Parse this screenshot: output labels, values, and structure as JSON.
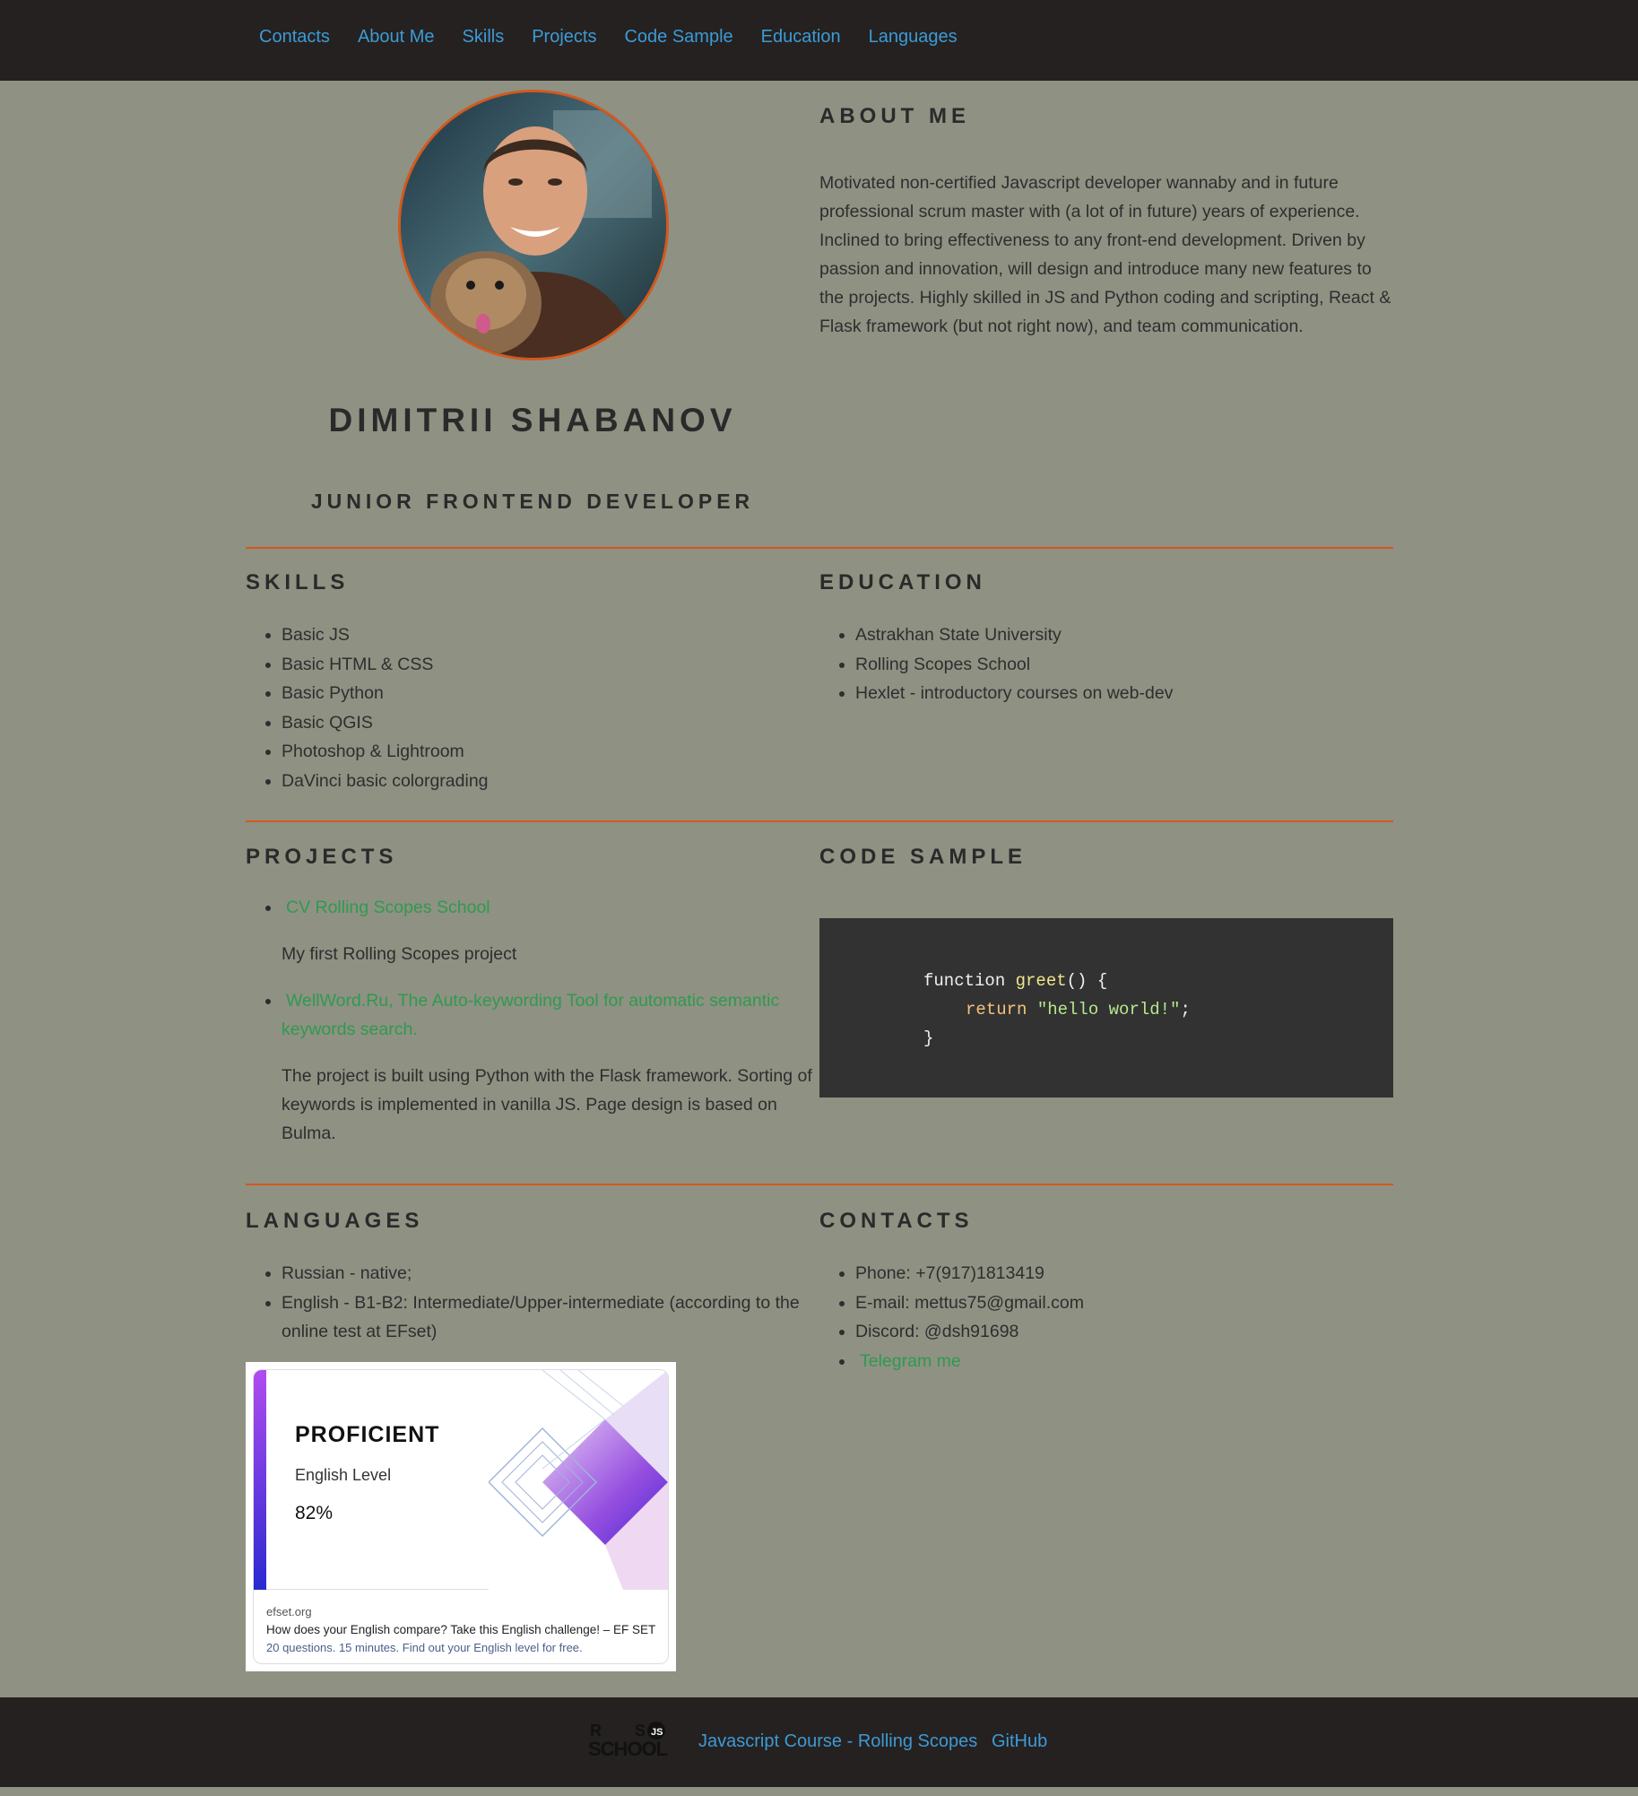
{
  "nav": {
    "items": [
      "Contacts",
      "About Me",
      "Skills",
      "Projects",
      "Code Sample",
      "Education",
      "Languages"
    ]
  },
  "profile": {
    "name": "DIMITRII SHABANOV",
    "role": "JUNIOR FRONTEND DEVELOPER"
  },
  "about": {
    "title": "ABOUT ME",
    "text": "Motivated non-certified Javascript developer wannaby and in future professional scrum master with (a lot of in future) years of experience. Inclined to bring effectiveness to any front-end development. Driven by passion and innovation, will design and introduce many new features to the projects. Highly skilled in JS and Python coding and scripting, React & Flask framework (but not right now), and team communication."
  },
  "skills": {
    "title": "SKILLS",
    "items": [
      "Basic JS",
      "Basic HTML & CSS",
      "Basic Python",
      "Basic QGIS",
      "Photoshop & Lightroom",
      "DaVinci basic colorgrading"
    ]
  },
  "education": {
    "title": "EDUCATION",
    "items": [
      "Astrakhan State University",
      "Rolling Scopes School",
      "Hexlet - introductory courses on web-dev"
    ]
  },
  "projects": {
    "title": "PROJECTS",
    "items": [
      {
        "link": "CV Rolling Scopes School",
        "desc": "My first Rolling Scopes project"
      },
      {
        "link": "WellWord.Ru, The Auto-keywording Tool for automatic semantic keywords search.",
        "desc": "The project is built using Python with the Flask framework. Sorting of keywords is implemented in vanilla JS. Page design is based on Bulma."
      }
    ]
  },
  "code": {
    "title": "CODE SAMPLE",
    "kw_function": "function",
    "fn_name": "greet",
    "sig_rest": "() {",
    "kw_return": "return",
    "str": "\"hello world!\"",
    "semi": ";",
    "close": "}"
  },
  "languages": {
    "title": "LANGUAGES",
    "items": [
      "Russian - native;",
      "English - B1-B2: Intermediate/Upper-intermediate (according to the online test at EFset)"
    ]
  },
  "efset": {
    "level": "PROFICIENT",
    "subtitle": "English Level",
    "percent": "82%",
    "site": "efset.org",
    "question": "How does your English compare? Take this English challenge! – EF SET",
    "note": "20 questions. 15 minutes. Find out your English level for free."
  },
  "contacts": {
    "title": "CONTACTS",
    "items": [
      "Phone: +7(917)1813419",
      "E-mail: mettus75@gmail.com",
      "Discord: @dsh91698"
    ],
    "telegram": "Telegram me"
  },
  "footer": {
    "logo_text": "RS SCHOOL",
    "course": "Javascript Course - Rolling Scopes",
    "github": "GitHub"
  },
  "colors": {
    "background": "#8f9183",
    "nav_bg": "#242120",
    "link_blue": "#3d9ad6",
    "link_green": "#2f9a4f",
    "accent_orange": "#d4581c",
    "code_bg": "#323232"
  }
}
